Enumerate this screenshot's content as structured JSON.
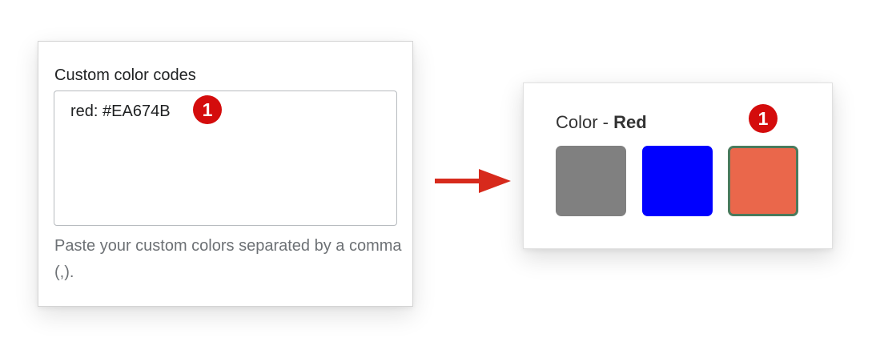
{
  "custom_colors_panel": {
    "label": "Custom color codes",
    "textarea_value": "red: #EA674B",
    "badge_number": "1",
    "help_text": "Paste your custom colors separated by a comma (,)."
  },
  "color_picker": {
    "label_prefix": "Color - ",
    "selected_name": "Red",
    "badge_number": "1",
    "swatches": [
      {
        "color": "#808080",
        "selected": false
      },
      {
        "color": "#0000FF",
        "selected": false
      },
      {
        "color": "#EA674B",
        "selected": true
      }
    ]
  },
  "colors": {
    "badge_red": "#D40C0C",
    "arrow_red": "#D72A1C",
    "selected_border": "#4A7A5C"
  }
}
